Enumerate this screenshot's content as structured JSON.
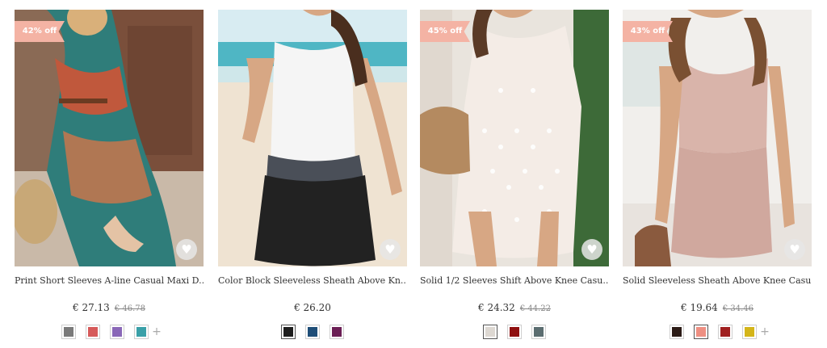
{
  "products": [
    {
      "discount": "42% off",
      "title": "Print Short Sleeves A-line Casual Maxi D...",
      "price": "€ 27.13",
      "old_price": "€ 46.78",
      "image": "woman-in-paisley-maxi-dress-photo",
      "swatches": [
        "#7a7a7a",
        "#d65a5a",
        "#8a68b8",
        "#3aa0a8"
      ],
      "more": "+"
    },
    {
      "discount": "",
      "title": "Color Block Sleeveless Sheath Above Kn...",
      "price": "€ 26.20",
      "old_price": "",
      "image": "woman-in-white-black-dress-beach-photo",
      "swatches": [
        "#1e1e1e",
        "#1f4e78",
        "#6b1f55"
      ],
      "more": ""
    },
    {
      "discount": "45% off",
      "title": "Solid 1/2 Sleeves Shift Above Knee Casu...",
      "price": "€ 24.32",
      "old_price": "€ 44.22",
      "image": "woman-in-white-dotted-dress-photo",
      "swatches": [
        "#ddd8d2",
        "#8e0f0f",
        "#5b6d70"
      ],
      "more": ""
    },
    {
      "discount": "43% off",
      "title": "Solid Sleeveless Sheath Above Knee Casu...",
      "price": "€ 19.64",
      "old_price": "€ 34.46",
      "image": "woman-in-pink-knit-dress-photo",
      "swatches": [
        "#2b1b16",
        "#ee8f82",
        "#a02020",
        "#d4b51a"
      ],
      "more": "+"
    }
  ],
  "icons": {
    "favorite": "heart-icon"
  }
}
